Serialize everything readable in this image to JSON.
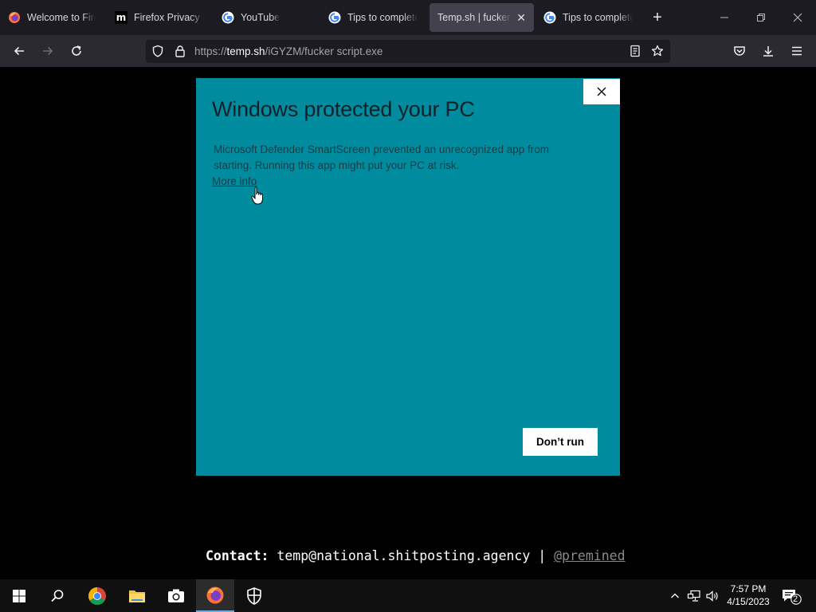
{
  "browser": {
    "tabs": [
      {
        "title": "Welcome to Firefox",
        "icon": "firefox-icon",
        "active": false
      },
      {
        "title": "Firefox Privacy Notice",
        "icon": "mozilla-icon",
        "active": false
      },
      {
        "title": "YouTube",
        "icon": "google-icon",
        "active": false
      },
      {
        "title": "Tips to complete",
        "icon": "google-icon",
        "active": false
      },
      {
        "title": "Temp.sh | fucker script.exe",
        "icon": "none",
        "active": true
      },
      {
        "title": "Tips to complete",
        "icon": "google-icon",
        "active": false
      }
    ],
    "new_tab_label": "+",
    "url": {
      "scheme": "https://",
      "host": "temp.sh",
      "path": "/iGYZM/fucker script.exe"
    }
  },
  "dialog": {
    "title": "Windows protected your PC",
    "body": "Microsoft Defender SmartScreen prevented an unrecognized app from starting. Running this app might put your PC at risk.",
    "more_info": "More info",
    "dont_run": "Don’t run",
    "close_label": "✕",
    "accent_color": "#008c9e"
  },
  "footer": {
    "contact_label": "Contact:",
    "email": "temp@national.shitposting.agency",
    "separator": "|",
    "handle": "@premined"
  },
  "taskbar": {
    "apps": [
      "windows-start",
      "search",
      "chrome",
      "file-explorer",
      "camera",
      "firefox",
      "windows-security"
    ],
    "clock_time": "7:57 PM",
    "clock_date": "4/15/2023",
    "notification_count": "2"
  }
}
